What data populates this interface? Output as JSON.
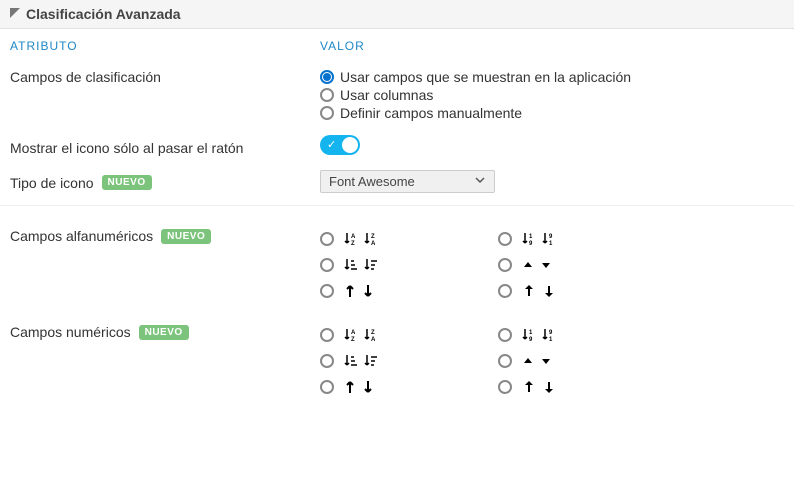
{
  "header": {
    "title": "Clasificación Avanzada"
  },
  "columns": {
    "attr": "ATRIBUTO",
    "val": "VALOR"
  },
  "badge_text": "NUEVO",
  "rows": {
    "sort_fields": {
      "label": "Campos de clasificación",
      "opts": {
        "app": "Usar campos que se muestran en la aplicación",
        "cols": "Usar columnas",
        "manual": "Definir campos manualmente"
      }
    },
    "hover_icon": {
      "label": "Mostrar el icono sólo al pasar el ratón"
    },
    "icon_type": {
      "label": "Tipo de icono",
      "select": "Font Awesome"
    },
    "alpha": {
      "label": "Campos alfanuméricos"
    },
    "numeric": {
      "label": "Campos numéricos"
    }
  }
}
